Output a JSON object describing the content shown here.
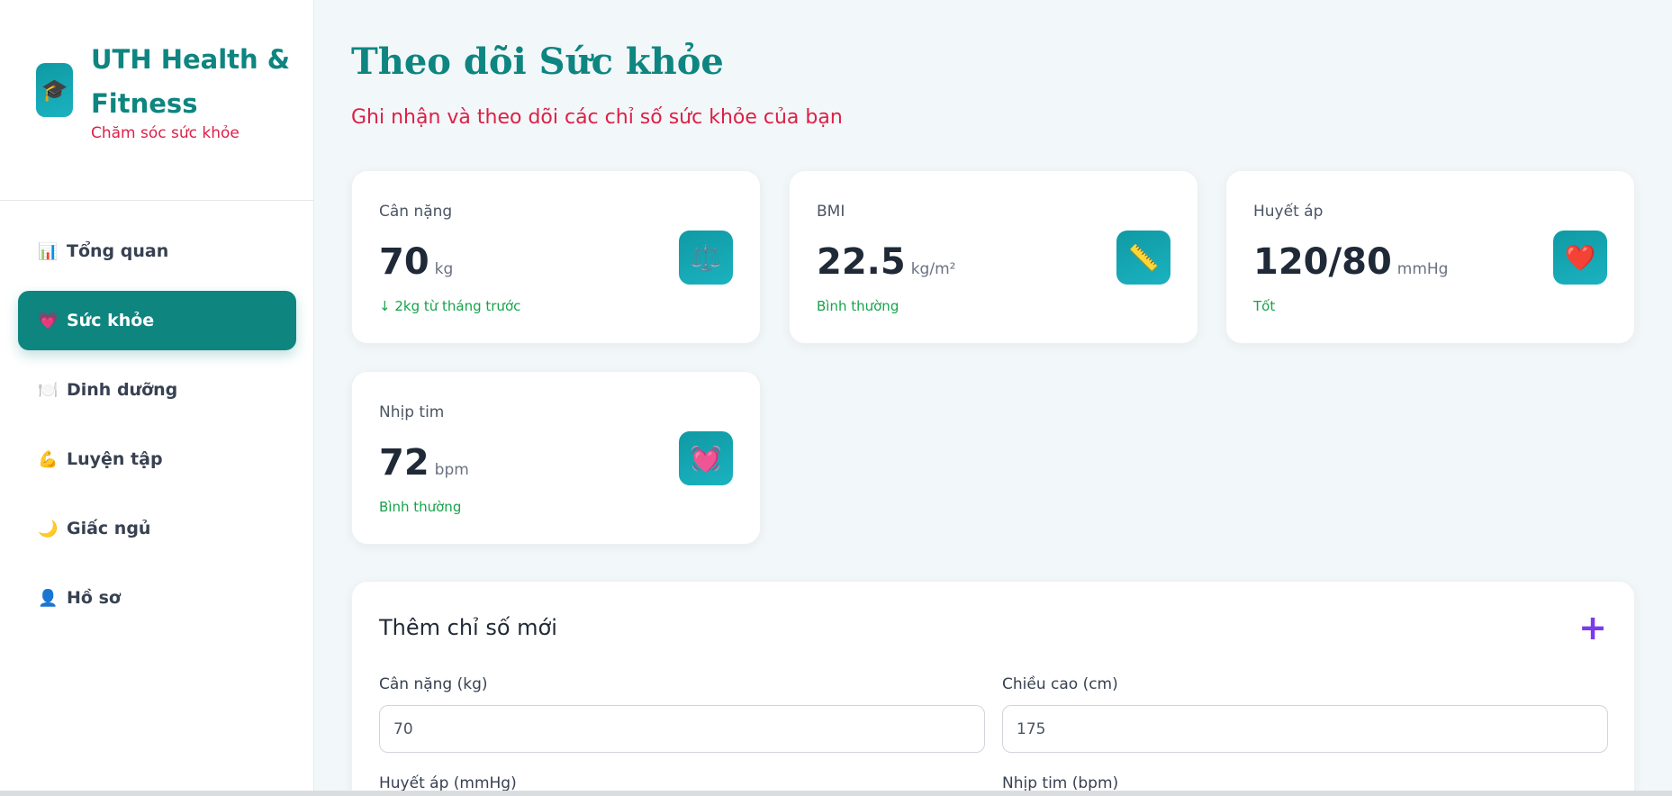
{
  "brand": {
    "title": "UTH Health & Fitness",
    "subtitle": "Chăm sóc sức khỏe",
    "logo_icon": "graduation-cap-icon"
  },
  "nav": [
    {
      "label": "Tổng quan",
      "icon": "chart-icon",
      "glyph": "📊",
      "active": false
    },
    {
      "label": "Sức khỏe",
      "icon": "heart-icon",
      "glyph": "💗",
      "active": true
    },
    {
      "label": "Dinh dưỡng",
      "icon": "plate-icon",
      "glyph": "🍽️",
      "active": false
    },
    {
      "label": "Luyện tập",
      "icon": "muscle-icon",
      "glyph": "💪",
      "active": false
    },
    {
      "label": "Giấc ngủ",
      "icon": "moon-icon",
      "glyph": "🌙",
      "active": false
    },
    {
      "label": "Hồ sơ",
      "icon": "user-icon",
      "glyph": "👤",
      "active": false
    }
  ],
  "header": {
    "title": "Theo dõi Sức khỏe",
    "subtitle": "Ghi nhận và theo dõi các chỉ số sức khỏe của bạn"
  },
  "cards": [
    {
      "label": "Cân nặng",
      "value": "70",
      "unit": "kg",
      "note": "↓ 2kg từ tháng trước",
      "icon": "scale-icon",
      "glyph": "⚖️"
    },
    {
      "label": "BMI",
      "value": "22.5",
      "unit": "kg/m²",
      "note": "Bình thường",
      "icon": "ruler-icon",
      "glyph": "📏"
    },
    {
      "label": "Huyết áp",
      "value": "120/80",
      "unit": "mmHg",
      "note": "Tốt",
      "icon": "heart-icon",
      "glyph": "❤️"
    },
    {
      "label": "Nhịp tim",
      "value": "72",
      "unit": "bpm",
      "note": "Bình thường",
      "icon": "heartbeat-icon",
      "glyph": "💓"
    }
  ],
  "form": {
    "title": "Thêm chỉ số mới",
    "add_symbol": "+",
    "fields": [
      {
        "label": "Cân nặng (kg)",
        "value": "70"
      },
      {
        "label": "Chiều cao (cm)",
        "value": "175"
      },
      {
        "label": "Huyết áp (mmHg)",
        "value": ""
      },
      {
        "label": "Nhịp tim (bpm)",
        "value": ""
      }
    ]
  },
  "colors": {
    "primary": "#0e8580",
    "accent_red": "#dc2047",
    "positive": "#16a34a",
    "add_purple": "#7c3aed"
  }
}
